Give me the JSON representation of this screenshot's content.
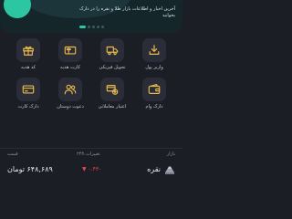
{
  "banner": {
    "text": "آخرین اخبار و اطلاعات بازار طلا و نقره را در دارک بخوانید",
    "slides": 5,
    "active_slide": 0,
    "logo_color": "#2dc6a2"
  },
  "tiles": [
    {
      "label": "واریز پول",
      "icon": "download-tray-icon"
    },
    {
      "label": "تحویل فیزیکی",
      "icon": "delivery-truck-icon"
    },
    {
      "label": "کارت هدیه",
      "icon": "gift-card-icon"
    },
    {
      "label": "کد هدیه",
      "icon": "gift-box-icon"
    },
    {
      "label": "دارک وام",
      "icon": "wallet-icon"
    },
    {
      "label": "اعتبار معاملاتی",
      "icon": "credit-icon"
    },
    {
      "label": "دعوت دوستان",
      "icon": "invite-friends-icon"
    },
    {
      "label": "دارک کارت",
      "icon": "dark-card-icon"
    }
  ],
  "market": {
    "header_market": "بازار",
    "header_change": "تغییرات ۲۴h",
    "header_price": "قیمت",
    "rows": [
      {
        "name": "نقره",
        "change": "▼ ۰.۴۳-",
        "price": "۶۴۸,۶۸۹ تومان",
        "icon": "silver-icon",
        "change_color": "#e5484d"
      }
    ]
  },
  "colors": {
    "background": "#1c1e25",
    "tile": "#2a2d37",
    "accent": "#e9b949",
    "negative": "#e5484d"
  }
}
